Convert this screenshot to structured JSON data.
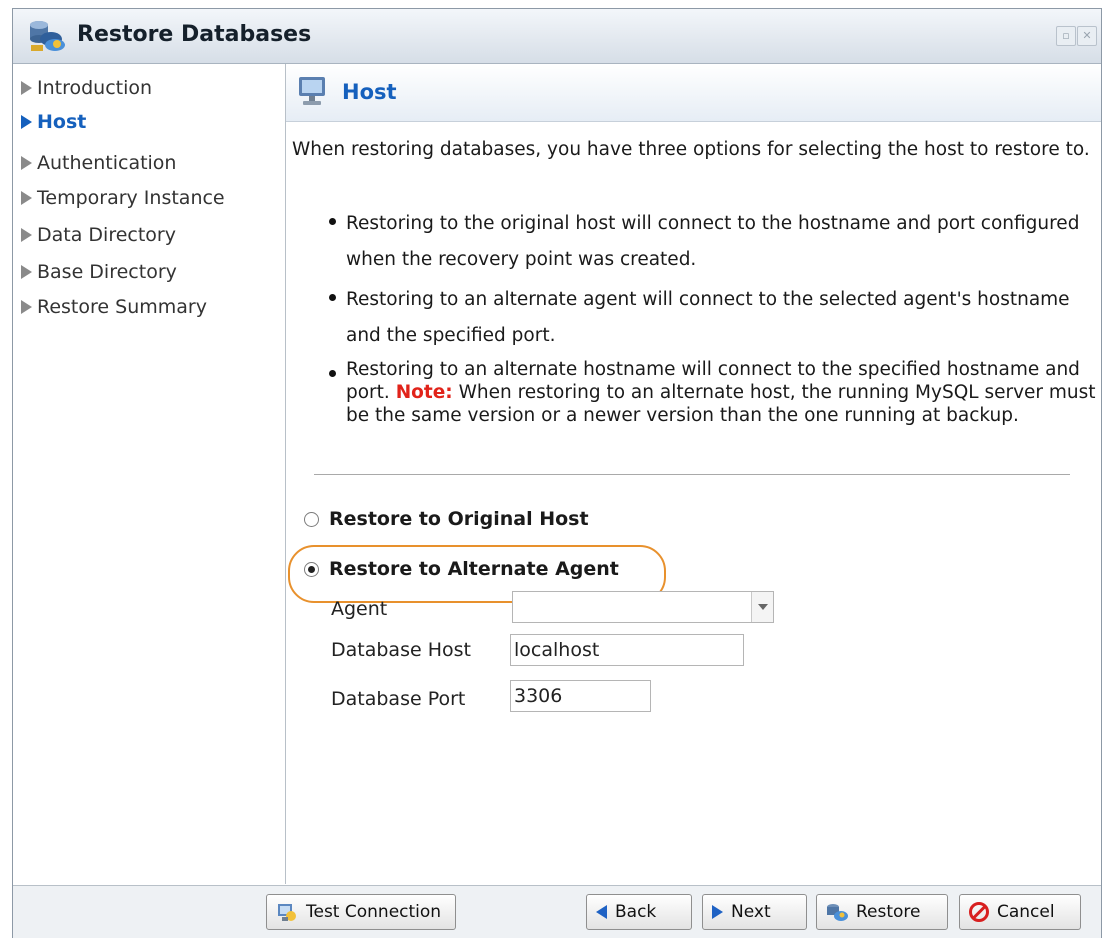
{
  "window": {
    "title": "Restore Databases",
    "title_icon": "database-restore-icon"
  },
  "nav": {
    "items": [
      {
        "label": "Introduction",
        "active": false
      },
      {
        "label": "Host",
        "active": true
      },
      {
        "label": "Authentication",
        "active": false
      },
      {
        "label": "Temporary Instance",
        "active": false
      },
      {
        "label": "Data Directory",
        "active": false
      },
      {
        "label": "Base Directory",
        "active": false
      },
      {
        "label": "Restore Summary",
        "active": false
      }
    ]
  },
  "panel": {
    "title": "Host",
    "icon": "monitor-icon",
    "intro": "When restoring databases, you have three options for selecting the host to restore to.",
    "bullets": [
      {
        "text": "Restoring to the original host will connect to the hostname and port configured when the recovery point was created."
      },
      {
        "text": "Restoring to an alternate agent will connect to the selected agent's hostname and the specified port."
      },
      {
        "text_a": "Restoring to an alternate hostname will connect to the specified hostname and port.",
        "note_label": "Note:",
        "text_b": "When restoring to an alternate host, the running MySQL server must be the same version or a newer version than the one running at backup."
      }
    ]
  },
  "options": {
    "original_label": "Restore to Original Host",
    "alternate_label": "Restore to Alternate Agent",
    "selected": "alternate"
  },
  "form": {
    "agent_label": "Agent",
    "agent_value": "",
    "db_host_label": "Database Host",
    "db_host_value": "localhost",
    "db_port_label": "Database Port",
    "db_port_value": "3306"
  },
  "footer": {
    "test_connection": "Test Connection",
    "back": "Back",
    "next": "Next",
    "restore": "Restore",
    "cancel": "Cancel"
  },
  "colors": {
    "accent": "#1560bd",
    "note": "#e1231a",
    "highlight": "#e8912d"
  }
}
